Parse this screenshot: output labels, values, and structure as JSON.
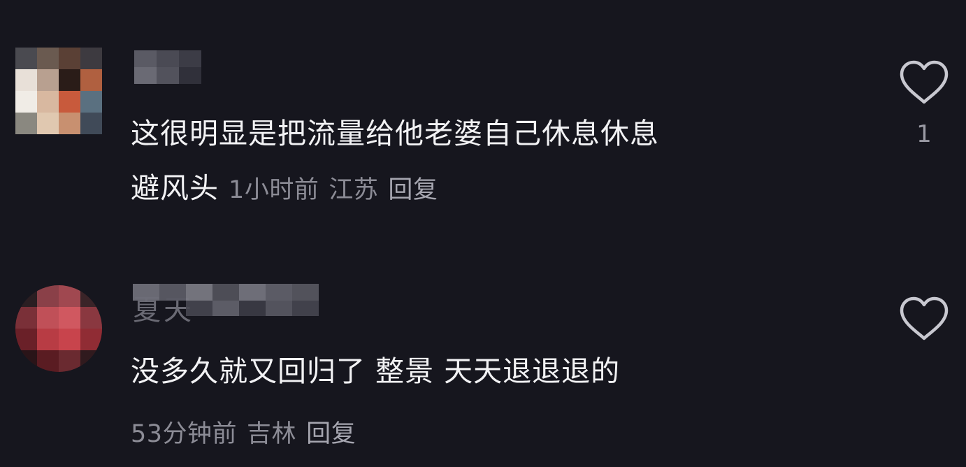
{
  "comments": [
    {
      "text_line1": "这很明显是把流量给他老婆自己休息休息",
      "text_line2": "避风头",
      "time": "1小时前",
      "location": "江苏",
      "reply_label": "回复",
      "like_count": "1"
    },
    {
      "username_partial": "夏天",
      "text": "没多久就又回归了 整景 天天退退退的",
      "time": "53分钟前",
      "location": "吉林",
      "reply_label": "回复",
      "like_count": ""
    }
  ],
  "colors": {
    "background": "#16161e",
    "text": "#f2f2f4",
    "meta": "#8c8c96",
    "icon": "#c8c8d0"
  }
}
